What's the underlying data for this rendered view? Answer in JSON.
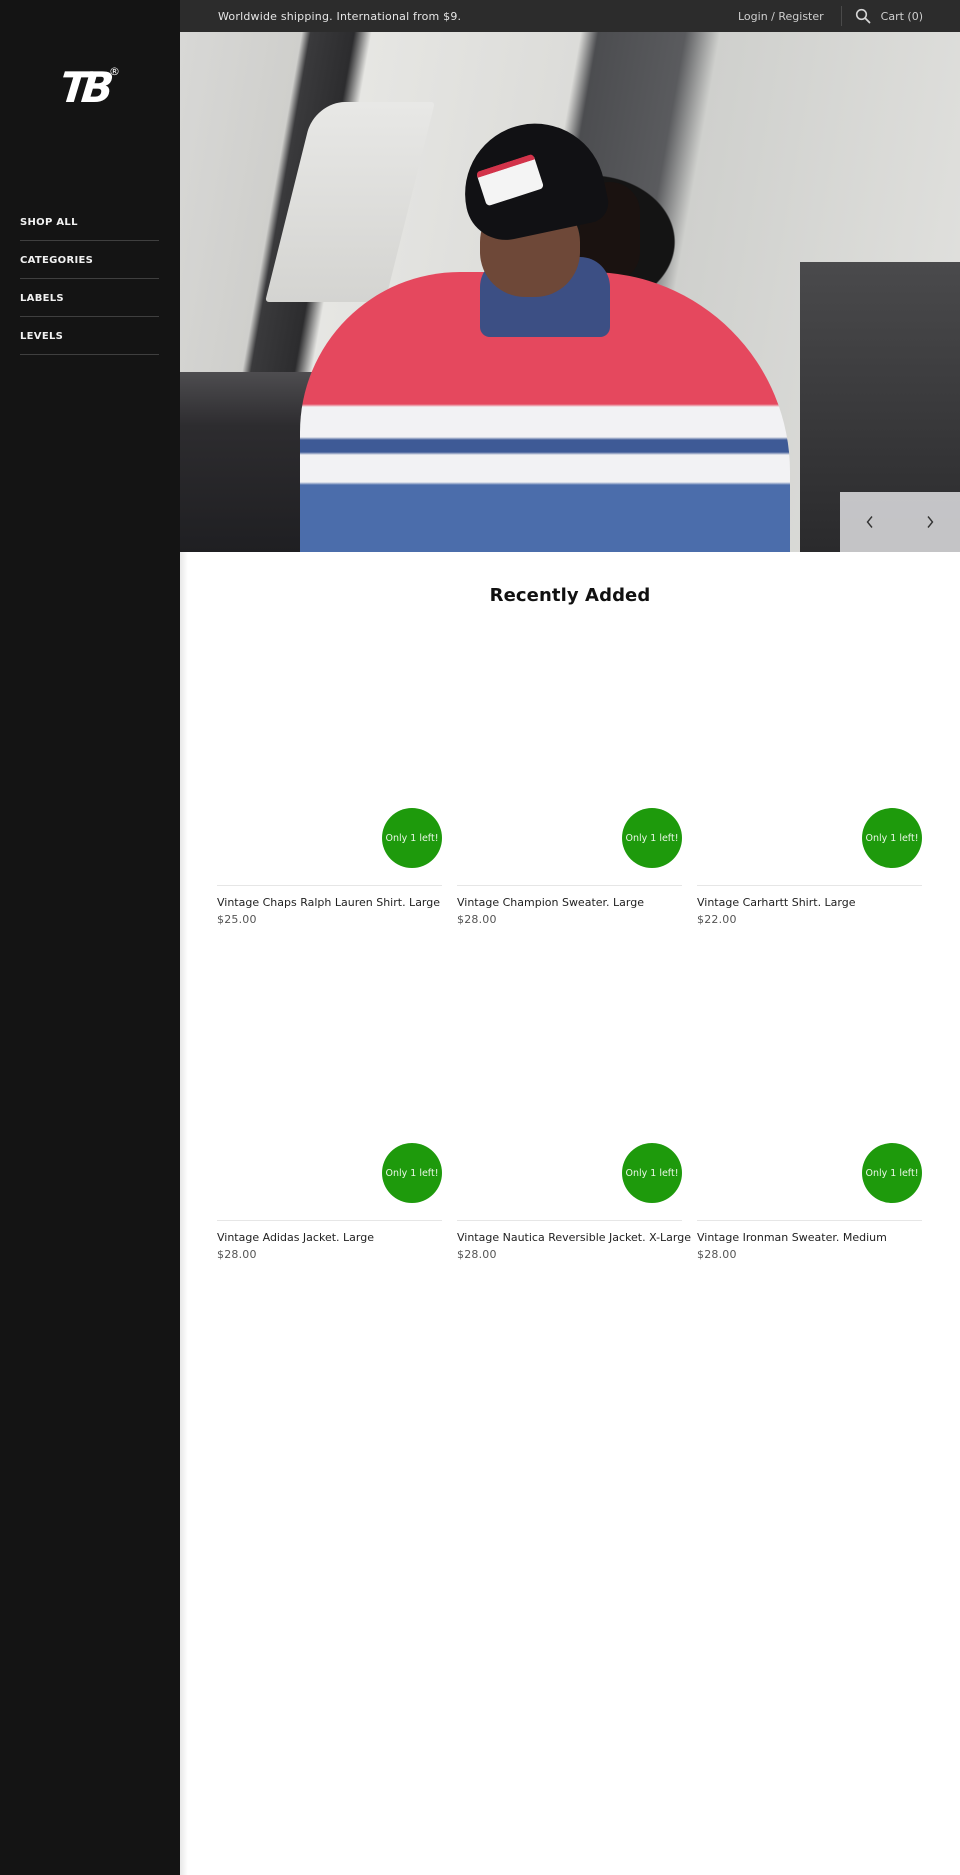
{
  "brand": {
    "logo_text": "TB",
    "registered_mark": "®"
  },
  "sidebar": {
    "items": [
      {
        "label": "SHOP ALL"
      },
      {
        "label": "CATEGORIES"
      },
      {
        "label": "LABELS"
      },
      {
        "label": "LEVELS"
      }
    ]
  },
  "topbar": {
    "announcement": "Worldwide shipping. International from $9.",
    "login_label": "Login / Register",
    "search_icon": "search-icon",
    "cart_label": "Cart (0)"
  },
  "hero": {
    "image_description": "Person in black Champion cap and red, white and blue 'America' windbreaker seated in a car",
    "prev_icon": "chevron-left-icon",
    "next_icon": "chevron-right-icon"
  },
  "section": {
    "title": "Recently Added"
  },
  "products": [
    {
      "title": "Vintage Chaps Ralph Lauren Shirt. Large",
      "price": "$25.00",
      "badge": "Only 1 left!"
    },
    {
      "title": "Vintage Champion Sweater. Large",
      "price": "$28.00",
      "badge": "Only 1 left!"
    },
    {
      "title": "Vintage Carhartt Shirt. Large",
      "price": "$22.00",
      "badge": "Only 1 left!"
    },
    {
      "title": "Vintage Adidas Jacket. Large",
      "price": "$28.00",
      "badge": "Only 1 left!"
    },
    {
      "title": "Vintage Nautica Reversible Jacket. X-Large",
      "price": "$28.00",
      "badge": "Only 1 left!"
    },
    {
      "title": "Vintage Ironman Sweater. Medium",
      "price": "$28.00",
      "badge": "Only 1 left!"
    }
  ],
  "colors": {
    "sidebar_bg": "#141414",
    "topbar_bg": "#2c2c2c",
    "badge_green": "#1e9a0c",
    "text_dark": "#111111"
  }
}
